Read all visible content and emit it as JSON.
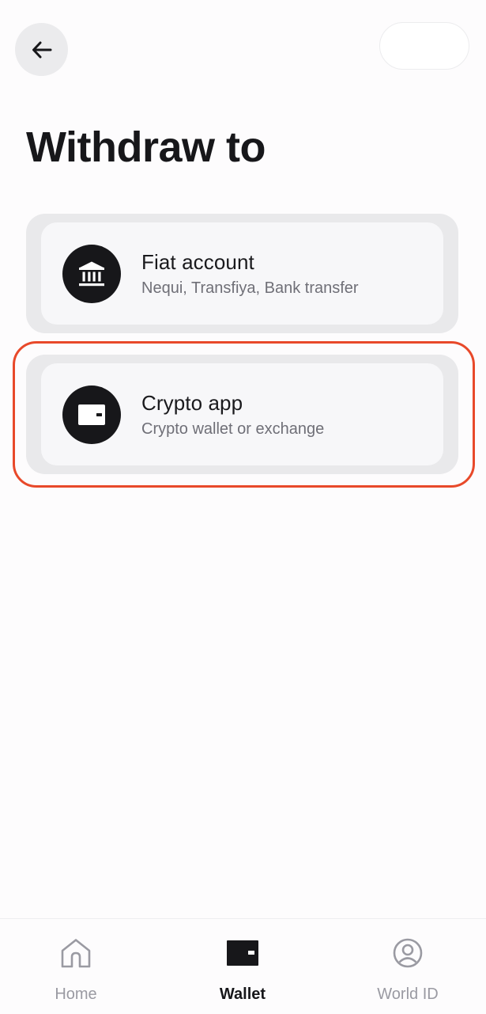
{
  "header": {
    "title": "Withdraw to",
    "back_icon": "arrow-left-icon"
  },
  "options": [
    {
      "title": "Fiat account",
      "subtitle": "Nequi, Transfiya, Bank transfer",
      "icon": "bank-icon"
    },
    {
      "title": "Crypto app",
      "subtitle": "Crypto wallet or exchange",
      "icon": "wallet-icon",
      "highlighted": true
    }
  ],
  "bottom_nav": {
    "items": [
      {
        "label": "Home",
        "icon": "home-icon",
        "active": false
      },
      {
        "label": "Wallet",
        "icon": "wallet-icon",
        "active": true
      },
      {
        "label": "World ID",
        "icon": "user-circle-icon",
        "active": false
      }
    ]
  },
  "colors": {
    "background": "#fdfcfd",
    "text_primary": "#17171a",
    "text_secondary": "#6f6f77",
    "card_outer": "#e9e9eb",
    "card_inner": "#f7f7f9",
    "highlight": "#e8492a",
    "nav_inactive": "#9a9aa2"
  }
}
